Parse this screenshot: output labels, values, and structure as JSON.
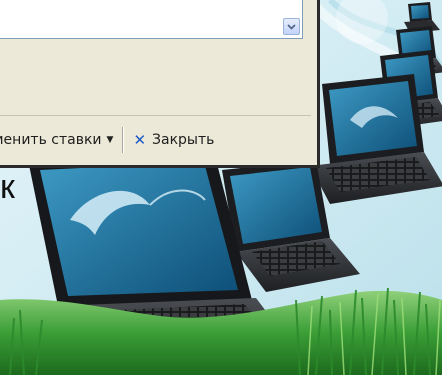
{
  "dialog": {
    "toolbar": {
      "change_rates_label": "менить ставки",
      "close_label": "Закрыть"
    }
  },
  "slide": {
    "partial_text": "к"
  },
  "colors": {
    "dialog_bg": "#ece9d8",
    "slide_bg": "#d6eef4",
    "grass": "#3aa33a",
    "close_icon": "#1d58c8"
  }
}
